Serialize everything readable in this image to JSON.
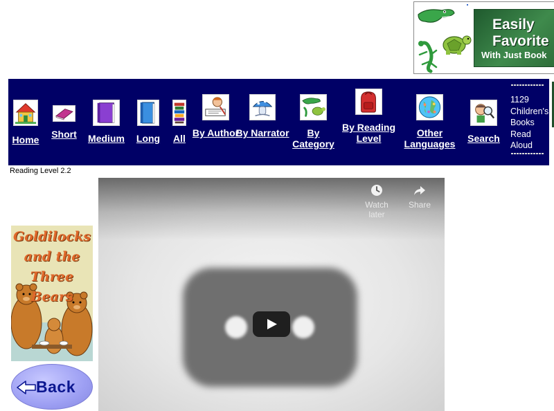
{
  "banner_ad": {
    "line1": "Easily",
    "line2": "Favorite",
    "line3": "With Just Book"
  },
  "nav": {
    "items": [
      {
        "key": "home",
        "label": "Home",
        "icon": "house-icon"
      },
      {
        "key": "short",
        "label": "Short",
        "icon": "thin-book-icon"
      },
      {
        "key": "medium",
        "label": "Medium",
        "icon": "purple-book-icon"
      },
      {
        "key": "long",
        "label": "Long",
        "icon": "blue-book-icon"
      },
      {
        "key": "all",
        "label": "All",
        "icon": "book-stack-icon"
      },
      {
        "key": "by-author",
        "label": "By Author",
        "icon": "author-writing-icon"
      },
      {
        "key": "by-narrator",
        "label": "By Narrator",
        "icon": "narrator-mushroom-icon"
      },
      {
        "key": "by-category",
        "label": "By Category",
        "icon": "animals-icon"
      },
      {
        "key": "by-reading-level",
        "label": "By Reading Level",
        "icon": "red-backpack-icon"
      },
      {
        "key": "other-languages",
        "label": "Other Languages",
        "icon": "globe-icon"
      },
      {
        "key": "search",
        "label": "Search",
        "icon": "magnifier-boy-icon"
      }
    ],
    "count_text": "1129 Children's Books Read Aloud"
  },
  "reading_level": "Reading Level 2.2",
  "book": {
    "cover_title": "Goldilocks and the Three Bears"
  },
  "back_button": {
    "label": "Back"
  },
  "video": {
    "watch_later": "Watch later",
    "share": "Share"
  }
}
